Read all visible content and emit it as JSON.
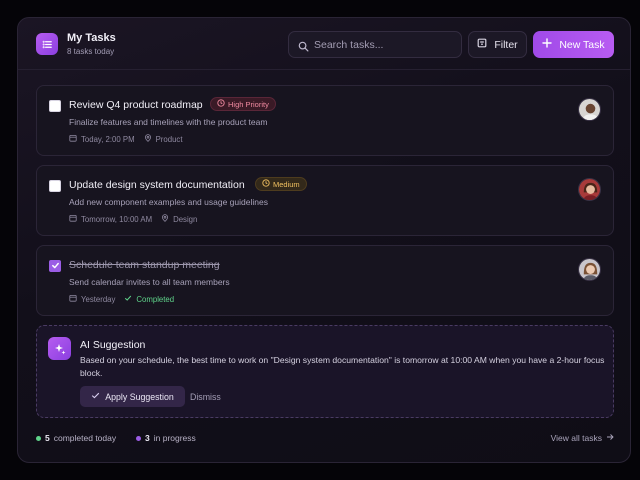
{
  "header": {
    "title": "My Tasks",
    "subtitle": "8 tasks today",
    "search_placeholder": "Search tasks...",
    "filter_label": "Filter",
    "new_task_label": "New Task"
  },
  "tasks": [
    {
      "title": "Review Q4 product roadmap",
      "badge": "High Priority",
      "description": "Finalize features and timelines with the product team",
      "date": "Today, 2:00 PM",
      "tag": "Product",
      "checked": false
    },
    {
      "title": "Update design system documentation",
      "badge": "Medium",
      "description": "Add new component examples and usage guidelines",
      "date": "Tomorrow, 10:00 AM",
      "tag": "Design",
      "checked": false
    },
    {
      "title": "Schedule team standup meeting",
      "description": "Send calendar invites to all team members",
      "date": "Yesterday",
      "status": "Completed",
      "checked": true
    }
  ],
  "ai": {
    "title": "AI Suggestion",
    "text": "Based on your schedule, the best time to work on \"Design system documentation\" is tomorrow at 10:00 AM when you have a 2-hour focus block.",
    "apply_label": "Apply Suggestion",
    "dismiss_label": "Dismiss"
  },
  "footer": {
    "completed_count": "5",
    "completed_label": "completed today",
    "progress_count": "3",
    "progress_label": "in progress",
    "view_all_label": "View all tasks"
  },
  "colors": {
    "accent": "#a04ae8",
    "high_priority": "#f08aa0",
    "medium": "#f0c060",
    "completed": "#5fd38a",
    "in_progress_dot": "#9b5de5"
  }
}
